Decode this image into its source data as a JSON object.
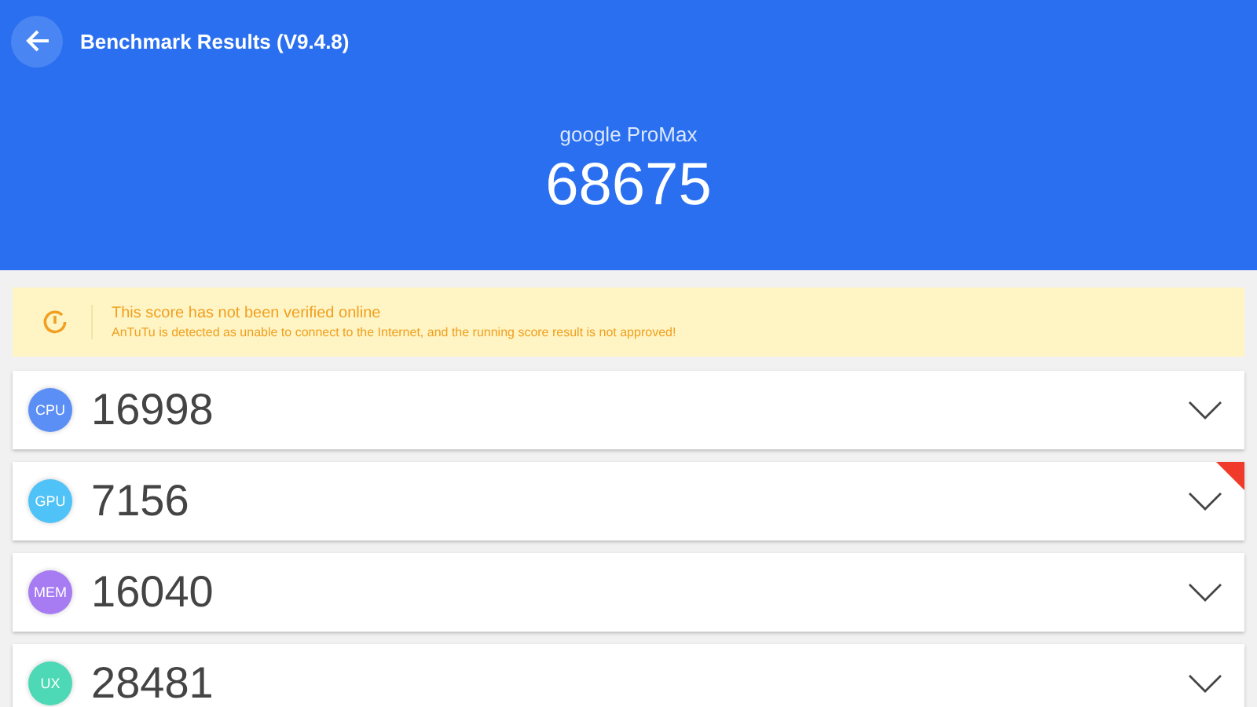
{
  "header": {
    "title": "Benchmark Results (V9.4.8)",
    "device": "google ProMax",
    "total_score": "68675"
  },
  "warning": {
    "title": "This score has not been verified online",
    "message": "AnTuTu is detected as unable to connect to the Internet, and the running score result is not approved!"
  },
  "scores": [
    {
      "badge": "CPU",
      "score": "16998",
      "color": "#5b8ff5",
      "ribbon": false,
      "expanded": false
    },
    {
      "badge": "GPU",
      "score": "7156",
      "color": "#4fc3f7",
      "ribbon": true,
      "expanded": false
    },
    {
      "badge": "MEM",
      "score": "16040",
      "color": "#a77cf2",
      "ribbon": false,
      "expanded": false
    },
    {
      "badge": "UX",
      "score": "28481",
      "color": "#4dd9b5",
      "ribbon": false,
      "expanded": false
    }
  ]
}
